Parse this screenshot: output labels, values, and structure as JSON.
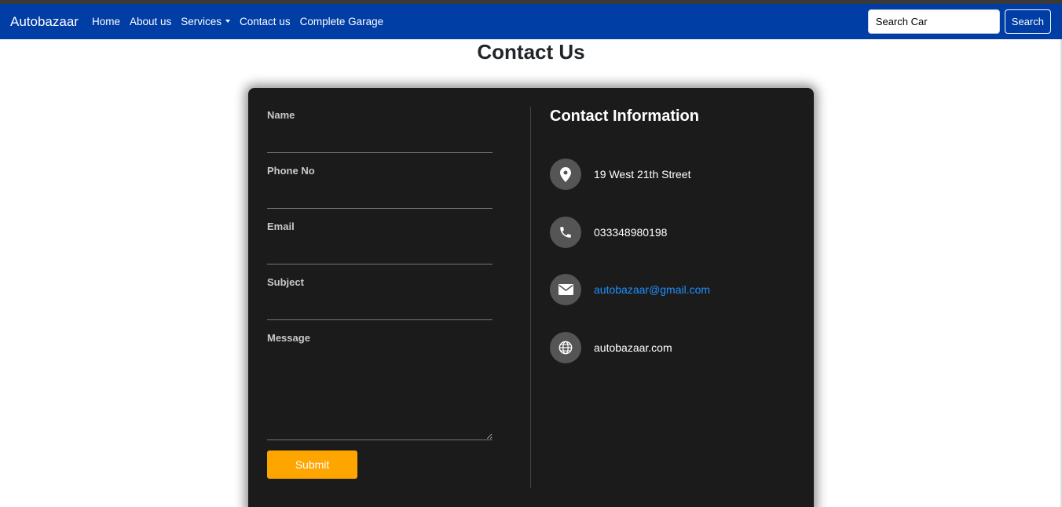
{
  "nav": {
    "brand": "Autobazaar",
    "links": [
      "Home",
      "About us",
      "Services",
      "Contact us",
      "Complete Garage"
    ],
    "search_placeholder": "Search Car",
    "search_button": "Search"
  },
  "page": {
    "title": "Contact Us"
  },
  "form": {
    "name_label": "Name",
    "phone_label": "Phone No",
    "email_label": "Email",
    "subject_label": "Subject",
    "message_label": "Message",
    "submit_label": "Submit",
    "button_color": "#ffa500"
  },
  "info": {
    "title": "Contact Information",
    "address": "19 West 21th Street",
    "phone": "033348980198",
    "email": "autobazaar@gmail.com",
    "website": "autobazaar.com",
    "icons": [
      "map-marker-icon",
      "phone-icon",
      "envelope-icon",
      "globe-icon"
    ]
  },
  "colors": {
    "navbar": "#003da5",
    "card": "#1b1b1b",
    "link": "#1e90ff"
  }
}
